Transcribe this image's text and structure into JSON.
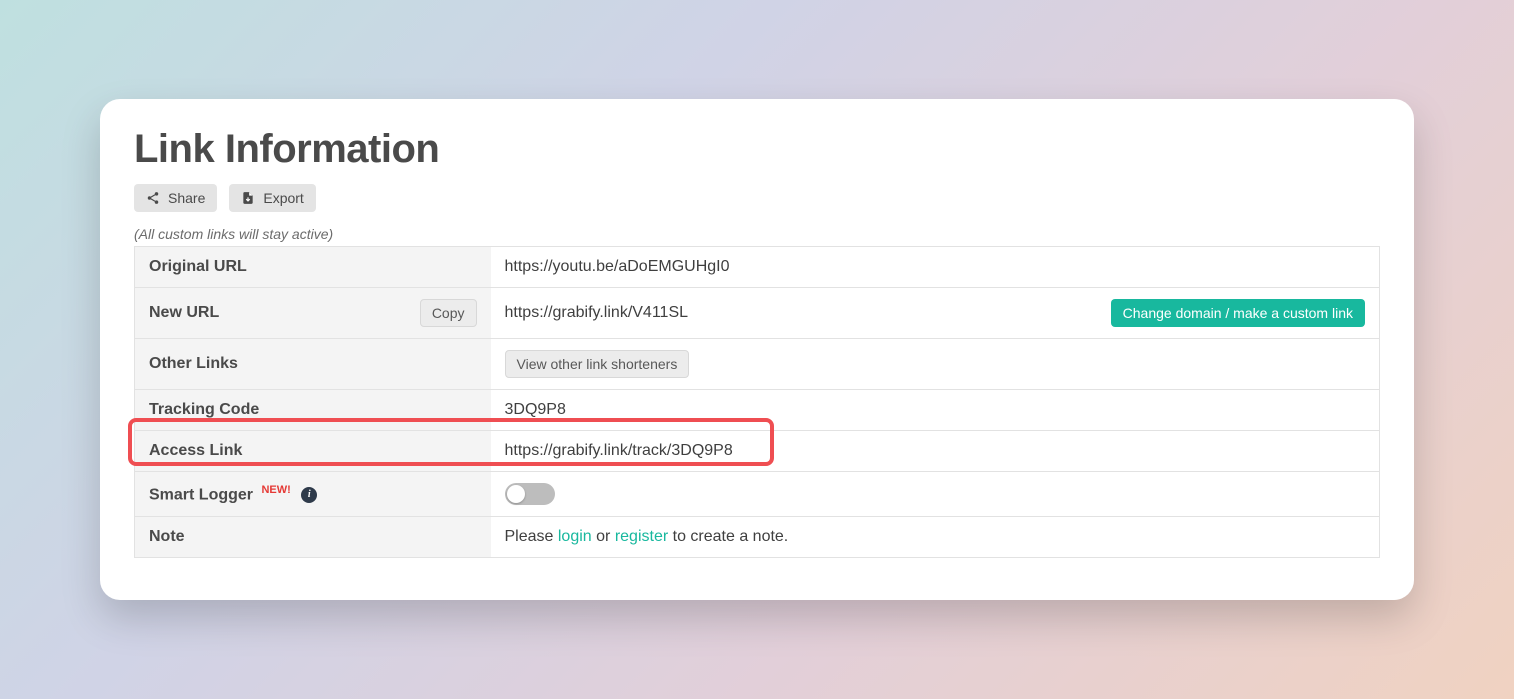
{
  "title": "Link Information",
  "toolbar": {
    "share_label": "Share",
    "export_label": "Export"
  },
  "subnote": "(All custom links will stay active)",
  "table": {
    "original_url": {
      "label": "Original URL",
      "value": "https://youtu.be/aDoEMGUHgI0"
    },
    "new_url": {
      "label": "New URL",
      "value": "https://grabify.link/V411SL",
      "copy_label": "Copy",
      "change_domain_label": "Change domain / make a custom link"
    },
    "other_links": {
      "label": "Other Links",
      "button_label": "View other link shorteners"
    },
    "tracking_code": {
      "label": "Tracking Code",
      "value": "3DQ9P8"
    },
    "access_link": {
      "label": "Access Link",
      "value": "https://grabify.link/track/3DQ9P8"
    },
    "smart_logger": {
      "label": "Smart Logger",
      "badge": "NEW!",
      "info_glyph": "i"
    },
    "note": {
      "label": "Note",
      "before": "Please ",
      "login": "login",
      "middle": " or ",
      "register": "register",
      "after": " to create a note."
    }
  }
}
